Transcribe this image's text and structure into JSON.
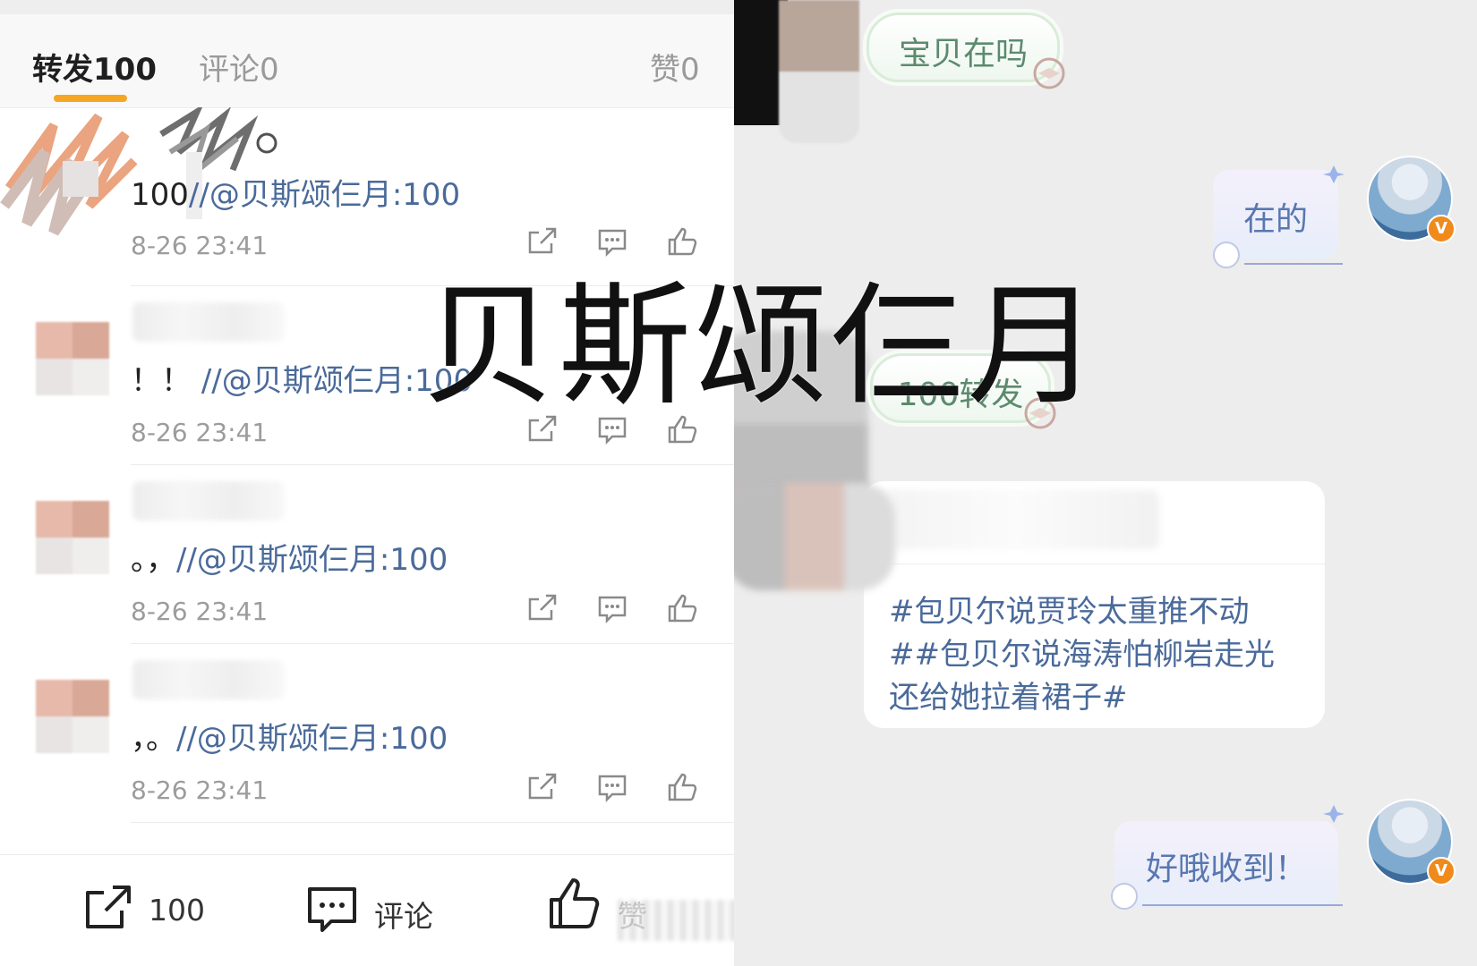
{
  "watermark": "贝斯颂仨月",
  "tabs": [
    {
      "label": "转发100",
      "active": true
    },
    {
      "label": "评论0",
      "active": false
    },
    {
      "label": "赞0",
      "active": false
    }
  ],
  "repost_items": [
    {
      "text_prefix": "100",
      "mention": "//@贝斯颂仨月:100",
      "time": "8-26 23:41"
    },
    {
      "text_prefix": "！！ ",
      "mention": "//@贝斯颂仨月:100",
      "time": "8-26 23:41"
    },
    {
      "text_prefix": "。，",
      "mention": "//@贝斯颂仨月:100",
      "time": "8-26 23:41"
    },
    {
      "text_prefix": "，。",
      "mention": "//@贝斯颂仨月:100",
      "time": "8-26 23:41"
    }
  ],
  "bottom_bar": {
    "repost_count": "100",
    "comment_label": "评论",
    "like_label": "赞"
  },
  "chat": {
    "msg1": "宝贝在吗",
    "reply1": "在的",
    "msg2": "100转发",
    "card_tags": [
      "#包贝尔说贾玲太重推不动",
      "##包贝尔说海涛怕柳岩走光",
      "还给她拉着裙子#"
    ],
    "reply2": "好哦收到！",
    "verified_badge": "V"
  },
  "colors": {
    "accent_tab": "#f5a623",
    "mention": "#4a6a9a",
    "chat_bg": "#ededed",
    "sticker_green": "#5c8a6e",
    "sticker_blue": "#5877b0",
    "badge_orange": "#f08a1b"
  }
}
